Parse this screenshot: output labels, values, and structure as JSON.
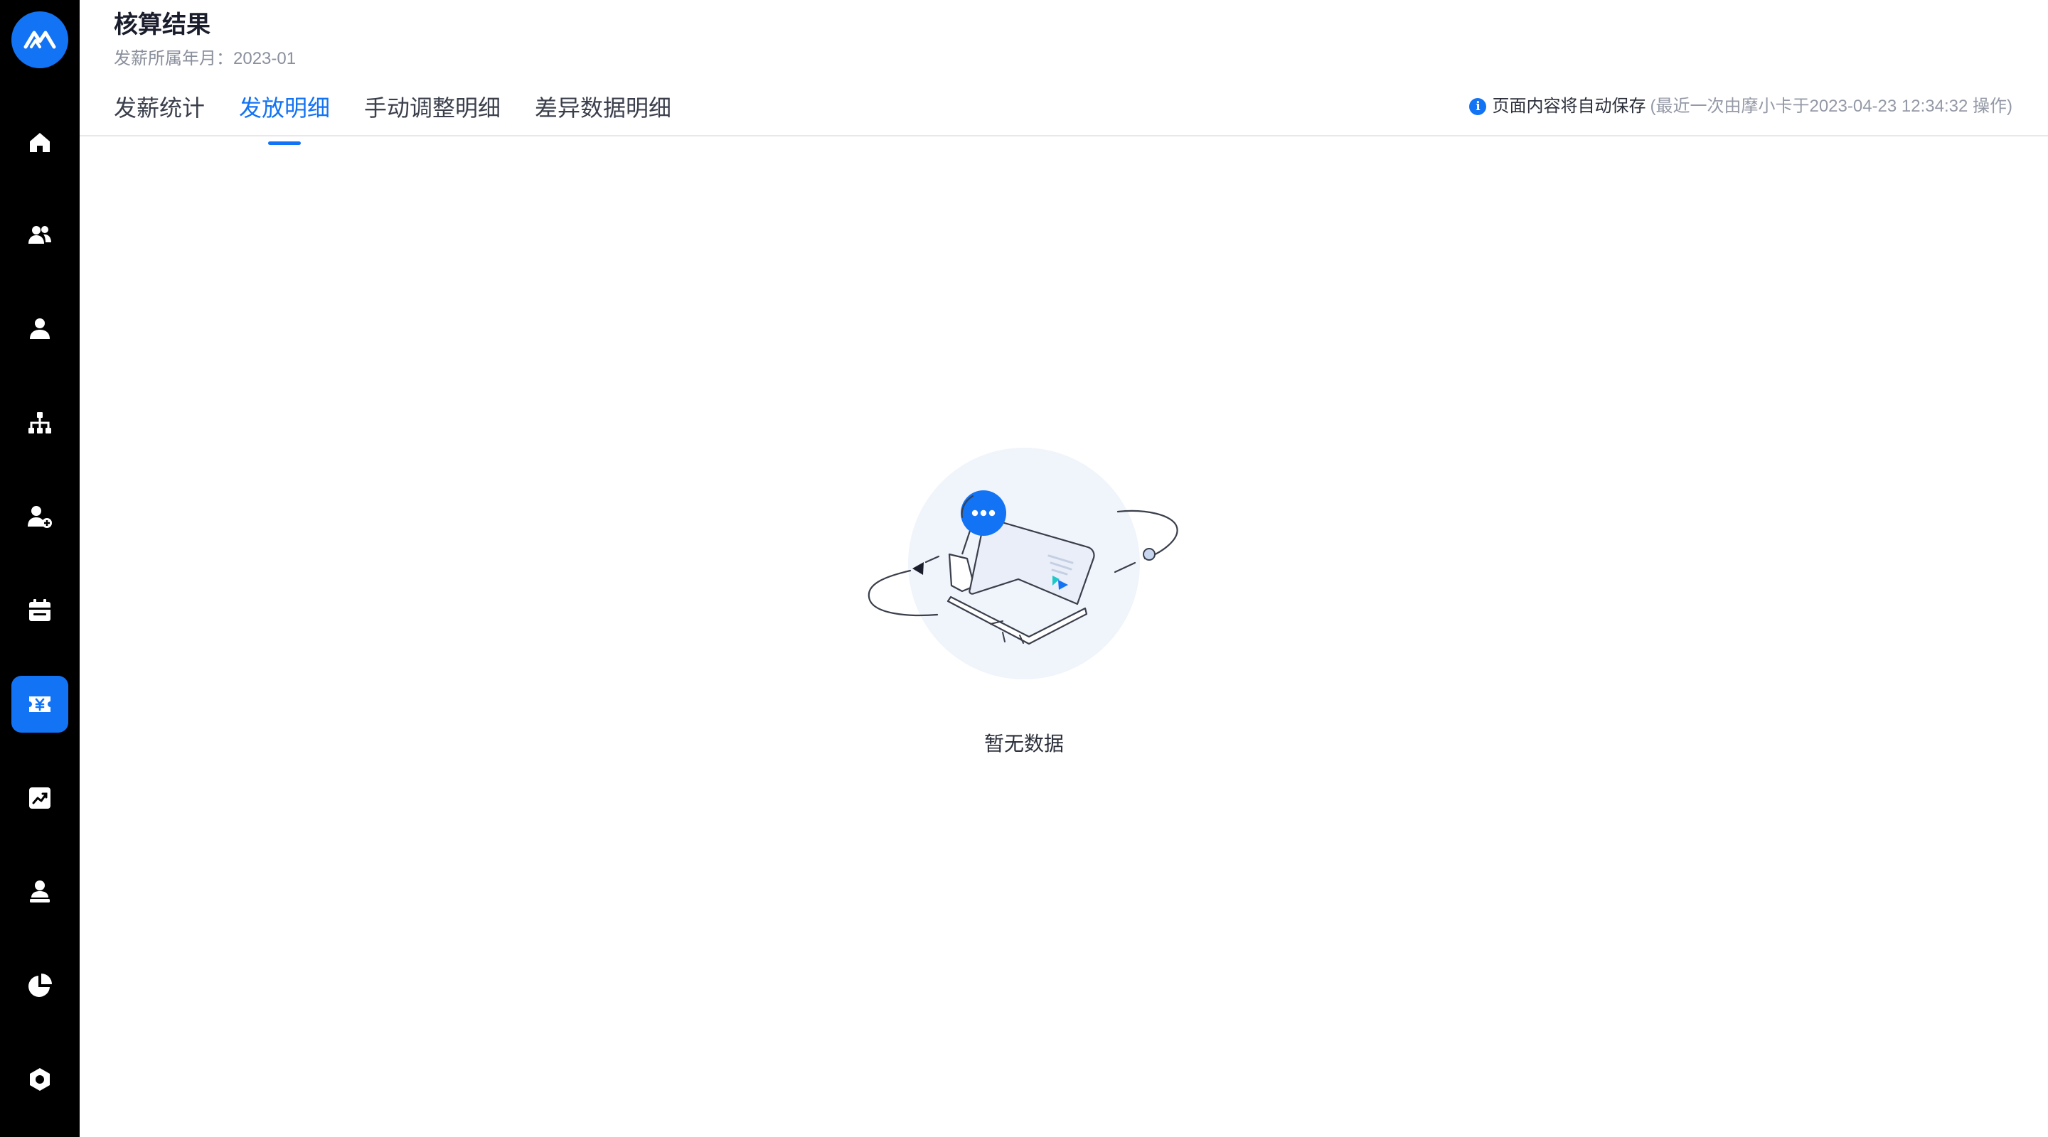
{
  "sidebar": {
    "logo_icon": "logo-mountain-icon",
    "items": [
      {
        "name": "home",
        "icon": "home-icon",
        "active": false
      },
      {
        "name": "employees",
        "icon": "users-icon",
        "active": false
      },
      {
        "name": "person",
        "icon": "user-icon",
        "active": false
      },
      {
        "name": "organization",
        "icon": "org-chart-icon",
        "active": false
      },
      {
        "name": "onboarding",
        "icon": "user-add-icon",
        "active": false
      },
      {
        "name": "attendance",
        "icon": "calendar-icon",
        "active": false
      },
      {
        "name": "payroll",
        "icon": "yen-ticket-icon",
        "active": true
      },
      {
        "name": "performance",
        "icon": "trend-chart-icon",
        "active": false
      },
      {
        "name": "profile",
        "icon": "badge-user-icon",
        "active": false
      },
      {
        "name": "reports",
        "icon": "pie-chart-icon",
        "active": false
      },
      {
        "name": "settings",
        "icon": "settings-icon",
        "active": false
      }
    ]
  },
  "header": {
    "title": "核算结果",
    "period_label": "发薪所属年月：",
    "period_value": "2023-01"
  },
  "tabs": [
    {
      "label": "发薪统计",
      "active": false
    },
    {
      "label": "发放明细",
      "active": true
    },
    {
      "label": "手动调整明细",
      "active": false
    },
    {
      "label": "差异数据明细",
      "active": false
    }
  ],
  "autosave": {
    "main_text": "页面内容将自动保存",
    "meta_text": "(最近一次由摩小卡于2023-04-23 12:34:32 操作)"
  },
  "empty_state": {
    "text": "暂无数据"
  },
  "colors": {
    "sidebar_bg": "#000000",
    "accent": "#1273f4",
    "title": "#1a1d2b",
    "muted": "#8a8f9c"
  }
}
